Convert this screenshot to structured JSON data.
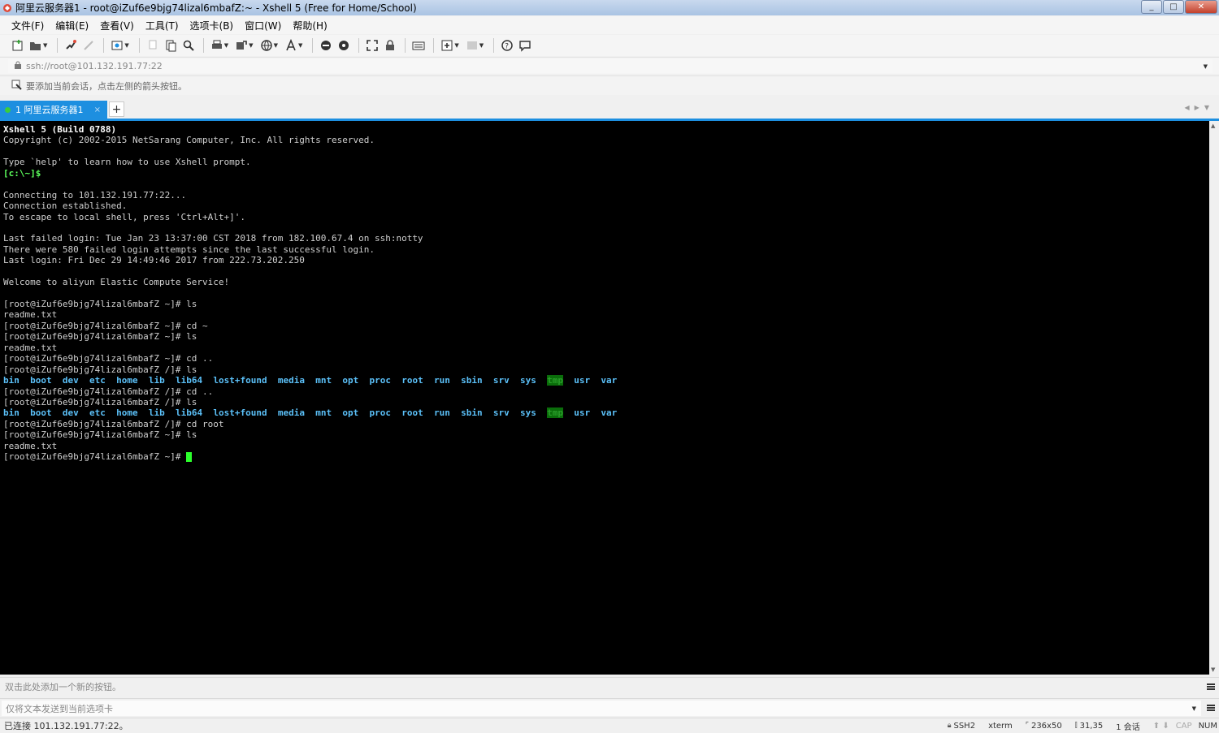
{
  "window": {
    "title": "阿里云服务器1 - root@iZuf6e9bjg74lizal6mbafZ:~ - Xshell 5 (Free for Home/School)",
    "minimize": "_",
    "maximize": "□",
    "close": "✕"
  },
  "menu": [
    "文件(F)",
    "编辑(E)",
    "查看(V)",
    "工具(T)",
    "选项卡(B)",
    "窗口(W)",
    "帮助(H)"
  ],
  "address": {
    "value": "ssh://root@101.132.191.77:22"
  },
  "hint": {
    "text": "要添加当前会话，点击左侧的箭头按钮。"
  },
  "tabs": [
    {
      "label": "1 阿里云服务器1",
      "close": "×"
    }
  ],
  "tab_add": "+",
  "terminal": {
    "header_bold": "Xshell 5 (Build 0788)",
    "lines_a": [
      "Copyright (c) 2002-2015 NetSarang Computer, Inc. All rights reserved.",
      "",
      "Type `help' to learn how to use Xshell prompt."
    ],
    "local_prompt": "[c:\\~]$",
    "lines_b": [
      "",
      "Connecting to 101.132.191.77:22...",
      "Connection established.",
      "To escape to local shell, press 'Ctrl+Alt+]'.",
      "",
      "Last failed login: Tue Jan 23 13:37:00 CST 2018 from 182.100.67.4 on ssh:notty",
      "There were 580 failed login attempts since the last successful login.",
      "Last login: Fri Dec 29 14:49:46 2017 from 222.73.202.250",
      "",
      "Welcome to aliyun Elastic Compute Service!",
      "",
      "[root@iZuf6e9bjg74lizal6mbafZ ~]# ls",
      "readme.txt",
      "[root@iZuf6e9bjg74lizal6mbafZ ~]# cd ~",
      "[root@iZuf6e9bjg74lizal6mbafZ ~]# ls",
      "readme.txt",
      "[root@iZuf6e9bjg74lizal6mbafZ ~]# cd ..",
      "[root@iZuf6e9bjg74lizal6mbafZ /]# ls"
    ],
    "dirs": [
      "bin",
      "boot",
      "dev",
      "etc",
      "home",
      "lib",
      "lib64",
      "lost+found",
      "media",
      "mnt",
      "opt",
      "proc",
      "root",
      "run",
      "sbin",
      "srv",
      "sys",
      "tmp",
      "usr",
      "var"
    ],
    "lines_c": [
      "[root@iZuf6e9bjg74lizal6mbafZ /]# cd ..",
      "[root@iZuf6e9bjg74lizal6mbafZ /]# ls"
    ],
    "lines_d": [
      "[root@iZuf6e9bjg74lizal6mbafZ /]# cd root",
      "[root@iZuf6e9bjg74lizal6mbafZ ~]# ls",
      "readme.txt"
    ],
    "final_prompt": "[root@iZuf6e9bjg74lizal6mbafZ ~]# "
  },
  "quickbar": {
    "text": "双击此处添加一个新的按钮。"
  },
  "sendbar": {
    "text": "仅将文本发送到当前选项卡"
  },
  "status": {
    "connection": "已连接 101.132.191.77:22。",
    "protocol": "SSH2",
    "terminal_type": "xterm",
    "size": "236x50",
    "cursor_pos": "31,35",
    "sessions": "1 会话",
    "cap": "CAP",
    "num": "NUM"
  },
  "colors": {
    "accent": "#1d8fe0",
    "dir": "#5bc0f8",
    "prompt_local": "#5cff5c",
    "cursor": "#2bff2b",
    "tmp_bg": "#0a6d0a"
  },
  "icons": [
    "new-session-icon",
    "open-folder-icon",
    "reconnect-icon",
    "disconnect-icon",
    "properties-icon",
    "copy-icon",
    "paste-icon",
    "find-icon",
    "print-icon",
    "transfer-icon",
    "globe-icon",
    "font-icon",
    "xftp-icon",
    "xagent-icon",
    "fullscreen-icon",
    "lock-icon",
    "keyboard-icon",
    "add-script-icon",
    "layout-icon",
    "help-icon",
    "chat-icon"
  ]
}
